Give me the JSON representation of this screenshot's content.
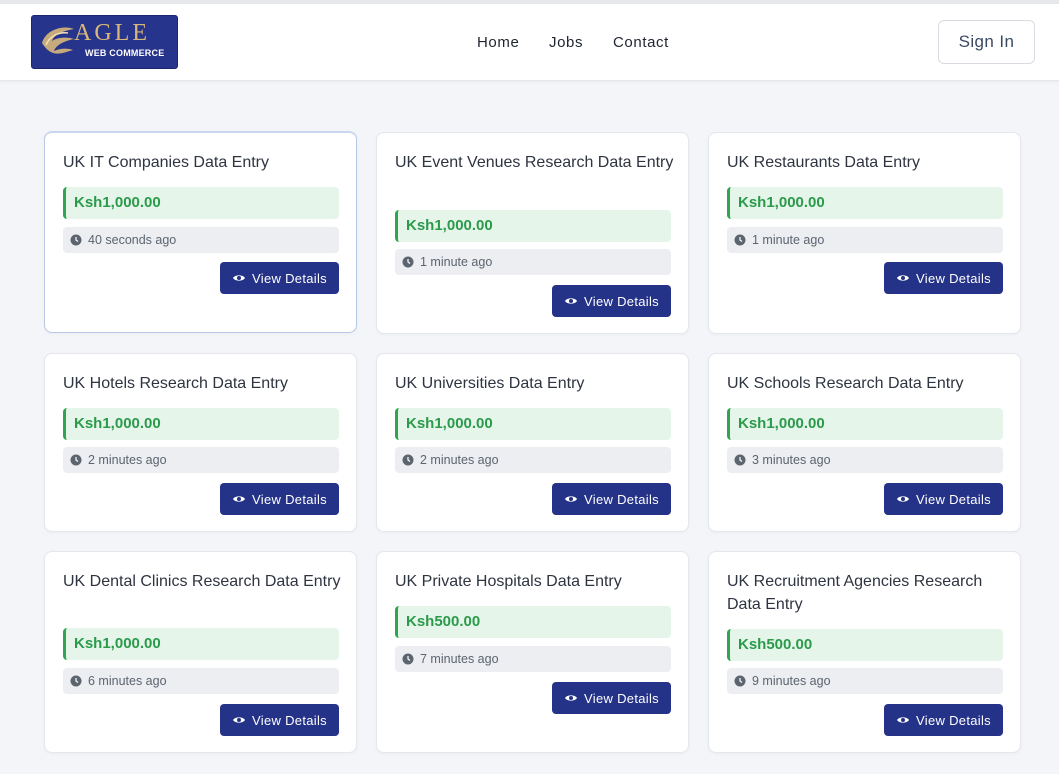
{
  "brand": {
    "word": "AGLE",
    "sub": "WEB COMMERCE"
  },
  "nav": {
    "home": "Home",
    "jobs": "Jobs",
    "contact": "Contact",
    "signin": "Sign In"
  },
  "button_label": "View Details",
  "jobs": [
    {
      "title": "UK IT Companies Data Entry",
      "price": "Ksh1,000.00",
      "time": "40 seconds ago"
    },
    {
      "title": "UK Event Venues Research Data Entry",
      "price": "Ksh1,000.00",
      "time": "1 minute ago"
    },
    {
      "title": "UK Restaurants Data Entry",
      "price": "Ksh1,000.00",
      "time": "1 minute ago"
    },
    {
      "title": "UK Hotels Research Data Entry",
      "price": "Ksh1,000.00",
      "time": "2 minutes ago"
    },
    {
      "title": "UK Universities Data Entry",
      "price": "Ksh1,000.00",
      "time": "2 minutes ago"
    },
    {
      "title": "UK Schools Research Data Entry",
      "price": "Ksh1,000.00",
      "time": "3 minutes ago"
    },
    {
      "title": "UK Dental Clinics Research Data Entry",
      "price": "Ksh1,000.00",
      "time": "6 minutes ago"
    },
    {
      "title": "UK Private Hospitals Data Entry",
      "price": "Ksh500.00",
      "time": "7 minutes ago"
    },
    {
      "title": "UK Recruitment Agencies Research Data Entry",
      "price": "Ksh500.00",
      "time": "9 minutes ago"
    }
  ],
  "colors": {
    "accent": "#243287",
    "price_text": "#2a9a4b",
    "price_bg": "#e6f5ea"
  },
  "icons": {
    "time": "clock-icon",
    "view": "eye-icon"
  }
}
